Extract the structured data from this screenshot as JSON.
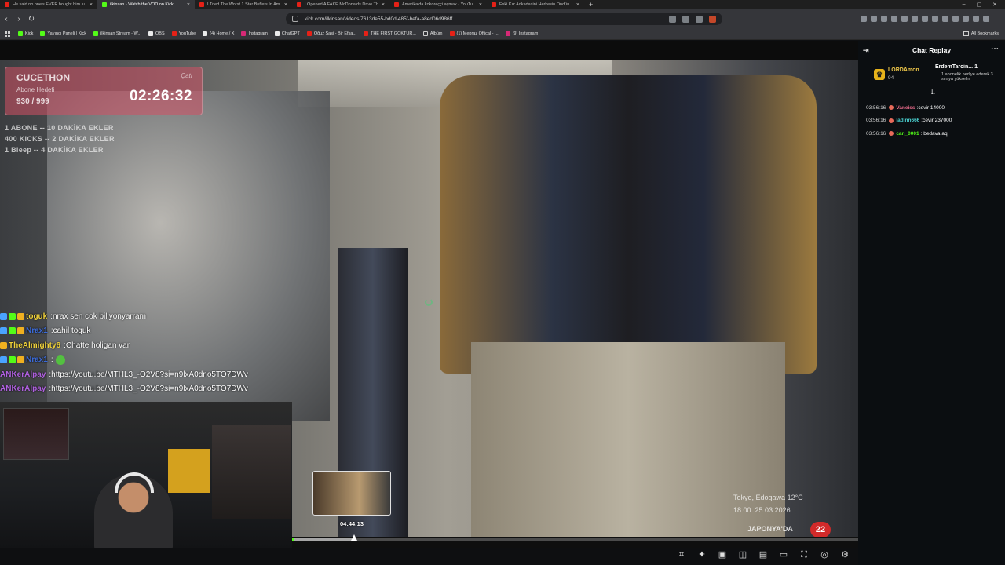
{
  "browser": {
    "tabs": [
      {
        "label": "He said no one's EVER bought him lu",
        "icon": "youtube-icon",
        "active": false
      },
      {
        "label": "ilkinsan - Watch the VOD on Kick",
        "icon": "kick-icon",
        "active": true
      },
      {
        "label": "I Tried The Worst 1 Star Buffets In Am",
        "icon": "youtube-icon",
        "active": false
      },
      {
        "label": "I Opened A FAKE McDonalds Drive Th",
        "icon": "youtube-icon",
        "active": false
      },
      {
        "label": "Amerika'da kokoreççi açmak - YouTu",
        "icon": "youtube-icon",
        "active": false
      },
      {
        "label": "Eski Kız Adkadasini Herkesin Öndün",
        "icon": "youtube-icon",
        "active": false
      }
    ],
    "new_tab": "+",
    "url": "kick.com/ilkinsan/videos/7613de55-bd0d-485f-befa-a8ed06d986ff",
    "bookmarks": [
      {
        "label": "Kick",
        "color": "g"
      },
      {
        "label": "Yayıncı Paneli | Kick",
        "color": "g"
      },
      {
        "label": "ilkinsan Stream - W...",
        "color": "g"
      },
      {
        "label": "OBS",
        "color": "w"
      },
      {
        "label": "YouTube",
        "color": "r"
      },
      {
        "label": "(4) Home / X",
        "color": "w"
      },
      {
        "label": "Instagram",
        "color": "p"
      },
      {
        "label": "ChatGPT",
        "color": "w"
      },
      {
        "label": "Oğuz Sasi - Bir Efsa...",
        "color": "r"
      },
      {
        "label": "THE FIRST GOKTUR...",
        "color": "r"
      },
      {
        "label": "Albüm",
        "color": "f"
      },
      {
        "label": "(1) Mepraz Offical - ...",
        "color": "r"
      },
      {
        "label": "(9) Instagram",
        "color": "p"
      }
    ],
    "all_bookmarks": "All Bookmarks"
  },
  "overlay": {
    "title": "CUCETHON",
    "subtitle": "Abone Hedefi",
    "count": "930 / 999",
    "brand": "Çatı",
    "timer": "02:26:32",
    "rules": [
      "1 ABONE -- 10 DAKİKA EKLER",
      "400 KICKS -- 2 DAKİKA EKLER",
      "1 Bleep -- 4 DAKİKA EKLER"
    ]
  },
  "video_chat": [
    {
      "user": "toguk",
      "user_color": "#f0d23a",
      "badges": [
        "blue",
        "grn",
        "yel"
      ],
      "text": "nrax sen cok biliyonyarram"
    },
    {
      "user": "Nrax1",
      "user_color": "#3a6ad8",
      "badges": [
        "blue",
        "grn",
        "yel"
      ],
      "text": "cahil toguk"
    },
    {
      "user": "TheAlmighty6",
      "user_color": "#f0d23a",
      "badges": [
        "yel"
      ],
      "text": "Chatte holigan var"
    },
    {
      "user": "Nrax1",
      "user_color": "#3a6ad8",
      "badges": [
        "blue",
        "grn",
        "yel"
      ],
      "text": ""
    },
    {
      "user": "ANKerAlpay",
      "user_color": "#b060e0",
      "badges": [],
      "text": "https://youtu.be/MTHL3_-O2V8?si=n9lxA0dno5TO7DWv"
    },
    {
      "user": "ANKerAlpay",
      "user_color": "#b060e0",
      "badges": [],
      "text": "https://youtu.be/MTHL3_-O2V8?si=n9lxA0dno5TO7DWv"
    }
  ],
  "weather": {
    "location": "Tokyo, Edogawa",
    "temp": "12°C",
    "time": "18:00",
    "date": "25.03.2026",
    "label": "JAPONYA'DA",
    "badge": "22"
  },
  "player": {
    "hover_time": "04:44:13",
    "progress": 0.003,
    "hover": 0.106,
    "controls": [
      "clip-icon",
      "sparkle-icon",
      "theater-icon",
      "miniplayer-icon",
      "cinema-icon",
      "pip-icon",
      "fullscreen-icon",
      "speed-icon",
      "settings-icon"
    ]
  },
  "chat_replay": {
    "title": "Chat Replay",
    "pinned": {
      "user": "LORDAmon",
      "count": "94",
      "gifter": "ErdemTarcin...",
      "gifter_count": "1",
      "gift_text": "1 abonelik hediye ederek 3. sıraya yükselin"
    },
    "messages": [
      {
        "time": "03:56:16",
        "user": "Vaneiss",
        "user_color": "#e86a8a",
        "text": ":cevir 14000"
      },
      {
        "time": "03:56:16",
        "user": "ladinn666",
        "user_color": "#4ad0d0",
        "text": ":cevir 237000"
      },
      {
        "time": "03:56:16",
        "user": "can_0001",
        "user_color": "#53fc18",
        "text": ": bedava aq"
      }
    ]
  }
}
